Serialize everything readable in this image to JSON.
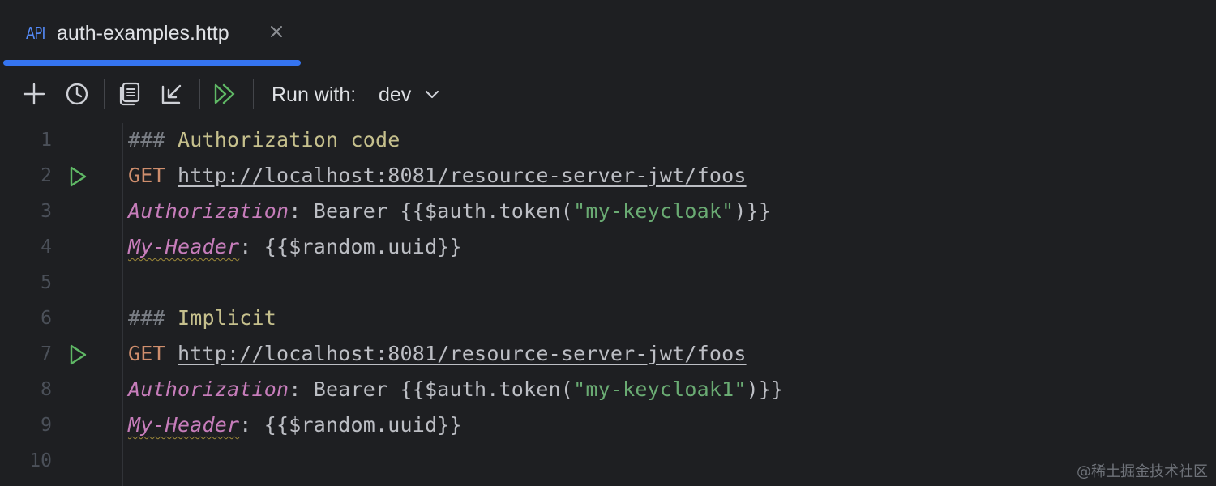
{
  "tab": {
    "badge": "API",
    "title": "auth-examples.http"
  },
  "toolbar": {
    "run_with_label": "Run with:",
    "environment": "dev"
  },
  "editor": {
    "lines": [
      {
        "num": "1",
        "parts": [
          {
            "cls": "c-comment",
            "text": "### "
          },
          {
            "cls": "c-title",
            "text": "Authorization code"
          }
        ]
      },
      {
        "num": "2",
        "run": true,
        "parts": [
          {
            "cls": "c-method",
            "text": "GET"
          },
          {
            "cls": "c-plain",
            "text": " "
          },
          {
            "cls": "c-url",
            "text": "http://localhost:8081/resource-server-jwt/foos"
          }
        ]
      },
      {
        "num": "3",
        "parts": [
          {
            "cls": "c-header",
            "text": "Authorization"
          },
          {
            "cls": "c-plain",
            "text": ": Bearer {{$auth.token("
          },
          {
            "cls": "c-string",
            "text": "\"my-keycloak\""
          },
          {
            "cls": "c-plain",
            "text": ")}}"
          }
        ]
      },
      {
        "num": "4",
        "parts": [
          {
            "cls": "c-header-warn",
            "text": "My-Header"
          },
          {
            "cls": "c-plain",
            "text": ": {{$random.uuid}}"
          }
        ]
      },
      {
        "num": "5",
        "parts": []
      },
      {
        "num": "6",
        "parts": [
          {
            "cls": "c-comment",
            "text": "### "
          },
          {
            "cls": "c-title",
            "text": "Implicit"
          }
        ]
      },
      {
        "num": "7",
        "run": true,
        "parts": [
          {
            "cls": "c-method",
            "text": "GET"
          },
          {
            "cls": "c-plain",
            "text": " "
          },
          {
            "cls": "c-url",
            "text": "http://localhost:8081/resource-server-jwt/foos"
          }
        ]
      },
      {
        "num": "8",
        "parts": [
          {
            "cls": "c-header",
            "text": "Authorization"
          },
          {
            "cls": "c-plain",
            "text": ": Bearer {{$auth.token("
          },
          {
            "cls": "c-string",
            "text": "\"my-keycloak1\""
          },
          {
            "cls": "c-plain",
            "text": ")}}"
          }
        ]
      },
      {
        "num": "9",
        "parts": [
          {
            "cls": "c-header-warn",
            "text": "My-Header"
          },
          {
            "cls": "c-plain",
            "text": ": {{$random.uuid}}"
          }
        ]
      },
      {
        "num": "10",
        "parts": []
      }
    ]
  },
  "watermark": "@稀土掘金技术社区",
  "colors": {
    "accent": "#3574f0",
    "run_green": "#5fb865",
    "background": "#1e1f22"
  },
  "icons": [
    "plus-icon",
    "history-icon",
    "copy-icon",
    "import-icon",
    "run-all-icon",
    "chevron-down-icon",
    "close-icon",
    "run-icon"
  ]
}
